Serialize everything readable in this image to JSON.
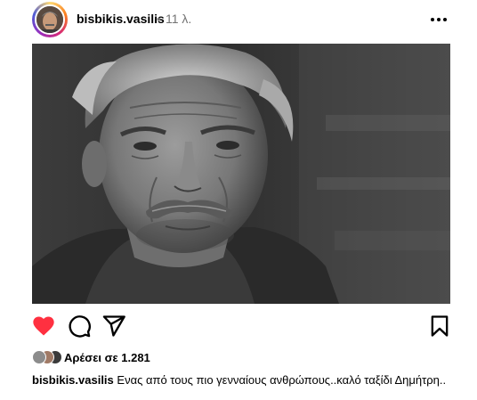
{
  "post": {
    "username": "bisbikis.vasilis",
    "separator": "•",
    "time_ago": "11 λ.",
    "likes_text": "Αρέσει σε 1.281",
    "caption_user": "bisbikis.vasilis",
    "caption_text": "Ενας από τους πιο γενναίους ανθρώπους..καλό ταξίδι Δημήτρη.."
  },
  "icons": {
    "more": "more-options-icon",
    "like": "heart-icon",
    "comment": "comment-icon",
    "share": "share-icon",
    "save": "bookmark-icon"
  },
  "colors": {
    "liked_heart": "#ff3040",
    "muted_text": "#737373"
  }
}
